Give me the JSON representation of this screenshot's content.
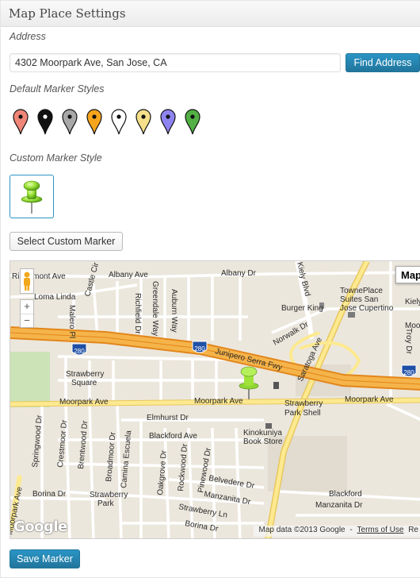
{
  "panel": {
    "title": "Map Place Settings"
  },
  "address": {
    "label": "Address",
    "value": "4302 Moorpark Ave, San Jose, CA",
    "button": "Find Address"
  },
  "default_markers": {
    "label": "Default Marker Styles",
    "colors": [
      "#f08677",
      "#111111",
      "#a8a8a8",
      "#f7a51d",
      "#ffffff",
      "#f5df8a",
      "#8e84f0",
      "#52b044"
    ]
  },
  "custom_marker": {
    "label": "Custom Marker Style",
    "button": "Select Custom Marker"
  },
  "map": {
    "type_button": "Map",
    "zoom_in": "+",
    "zoom_out": "−",
    "google_logo": "Google",
    "attribution": "Map data ©2013 Google",
    "terms": "Terms of Use",
    "report": "Re",
    "labels": {
      "ridgemont": "Ridgemont Ave",
      "albany_ave": "Albany Ave",
      "albany_dr": "Albany Dr",
      "kiely_top": "Kiely Blvd",
      "kiely_right": "Kiely",
      "loma_linda": "Loma Linda",
      "malero": "Malero Pl",
      "castle": "Castle Cir",
      "richfield": "Richfield Dr",
      "greendale": "Greendale Way",
      "auburn": "Auburn Way",
      "burger_king": "Burger King",
      "towneplace_1": "TownePlace",
      "towneplace_2": "Suites San",
      "towneplace_3": "Jose Cupertino",
      "norwalk": "Norwalk Dr",
      "saratoga": "Saratoga Ave",
      "junipero": "Junipero Serra Fwy",
      "hw280_a": "280",
      "hw280_b": "280",
      "hw280_c": "280",
      "troy": "Troy Dr",
      "moo": "Moo",
      "strawberry_sq_1": "Strawberry",
      "strawberry_sq_2": "Square",
      "moorpark_left": "Moorpark Ave",
      "moorpark_mid": "Moorpark Ave",
      "moorpark_right": "Moorpark Ave",
      "moorpark_vert": "Moorpark Ave",
      "shell_1": "Strawberry",
      "shell_2": "Park Shell",
      "elmhurst": "Elmhurst Dr",
      "blackford_ave": "Blackford Ave",
      "kinokuniya_1": "Kinokuniya",
      "kinokuniya_2": "Book Store",
      "springwood": "Springwood Dr",
      "crestmoor": "Crestmoor Dr",
      "brentwood": "Brentwood Dr",
      "broadmoor": "Broadmoor Dr",
      "camina": "Camina Escuela",
      "oakgrove": "Oakgrove Dr",
      "rockwood": "Rockwood Dr",
      "pinewood": "Pinewood Dr",
      "belvedere": "Belvedere Dr",
      "manzanita_1": "Manzanita Dr",
      "manzanita_2": "Manzanita Dr",
      "blackford_school": "Blackford",
      "borina_left": "Borina Dr",
      "strawberry_park_1": "Strawberry",
      "strawberry_park_2": "Park",
      "strawberry_ln": "Strawberry Ln",
      "borina_bottom": "Borina Dr"
    }
  },
  "save_button": "Save Marker"
}
